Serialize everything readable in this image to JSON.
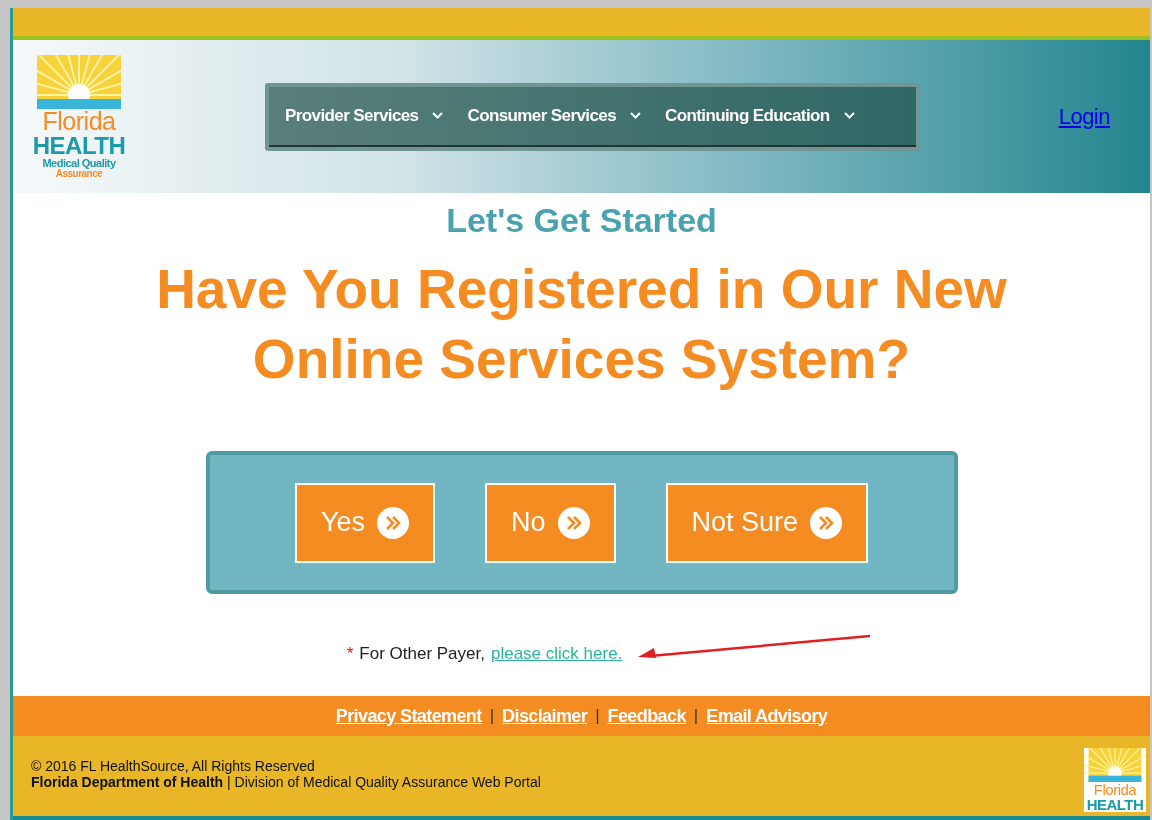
{
  "logo": {
    "line_1": "Florida",
    "line_2": "HEALTH",
    "line_3": "Medical Quality",
    "line_4": "Assurance"
  },
  "nav": [
    {
      "label": "Provider Services"
    },
    {
      "label": "Consumer Services"
    },
    {
      "label": "Continuing Education"
    }
  ],
  "login": "Login",
  "subtitle": "Let's Get Started",
  "headline": "Have You Registered in Our New Online Services System?",
  "choices": [
    {
      "label": "Yes"
    },
    {
      "label": "No"
    },
    {
      "label": "Not Sure"
    }
  ],
  "note": {
    "marker": "*",
    "text": "For Other Payer,",
    "link": "please click here."
  },
  "footer_links": [
    {
      "label": "Privacy Statement"
    },
    {
      "label": "Disclaimer"
    },
    {
      "label": "Feedback"
    },
    {
      "label": "Email Advisory"
    }
  ],
  "footer_separators": [
    "|",
    "|",
    "|"
  ],
  "copyright": "© 2016 FL HealthSource, All Rights Reserved",
  "department": "**Florida Department of Health** | Division of Medical Quality Assurance Web Portal",
  "footer_logo": {
    "line_1": "Florida",
    "line_2": "HEALTH"
  }
}
